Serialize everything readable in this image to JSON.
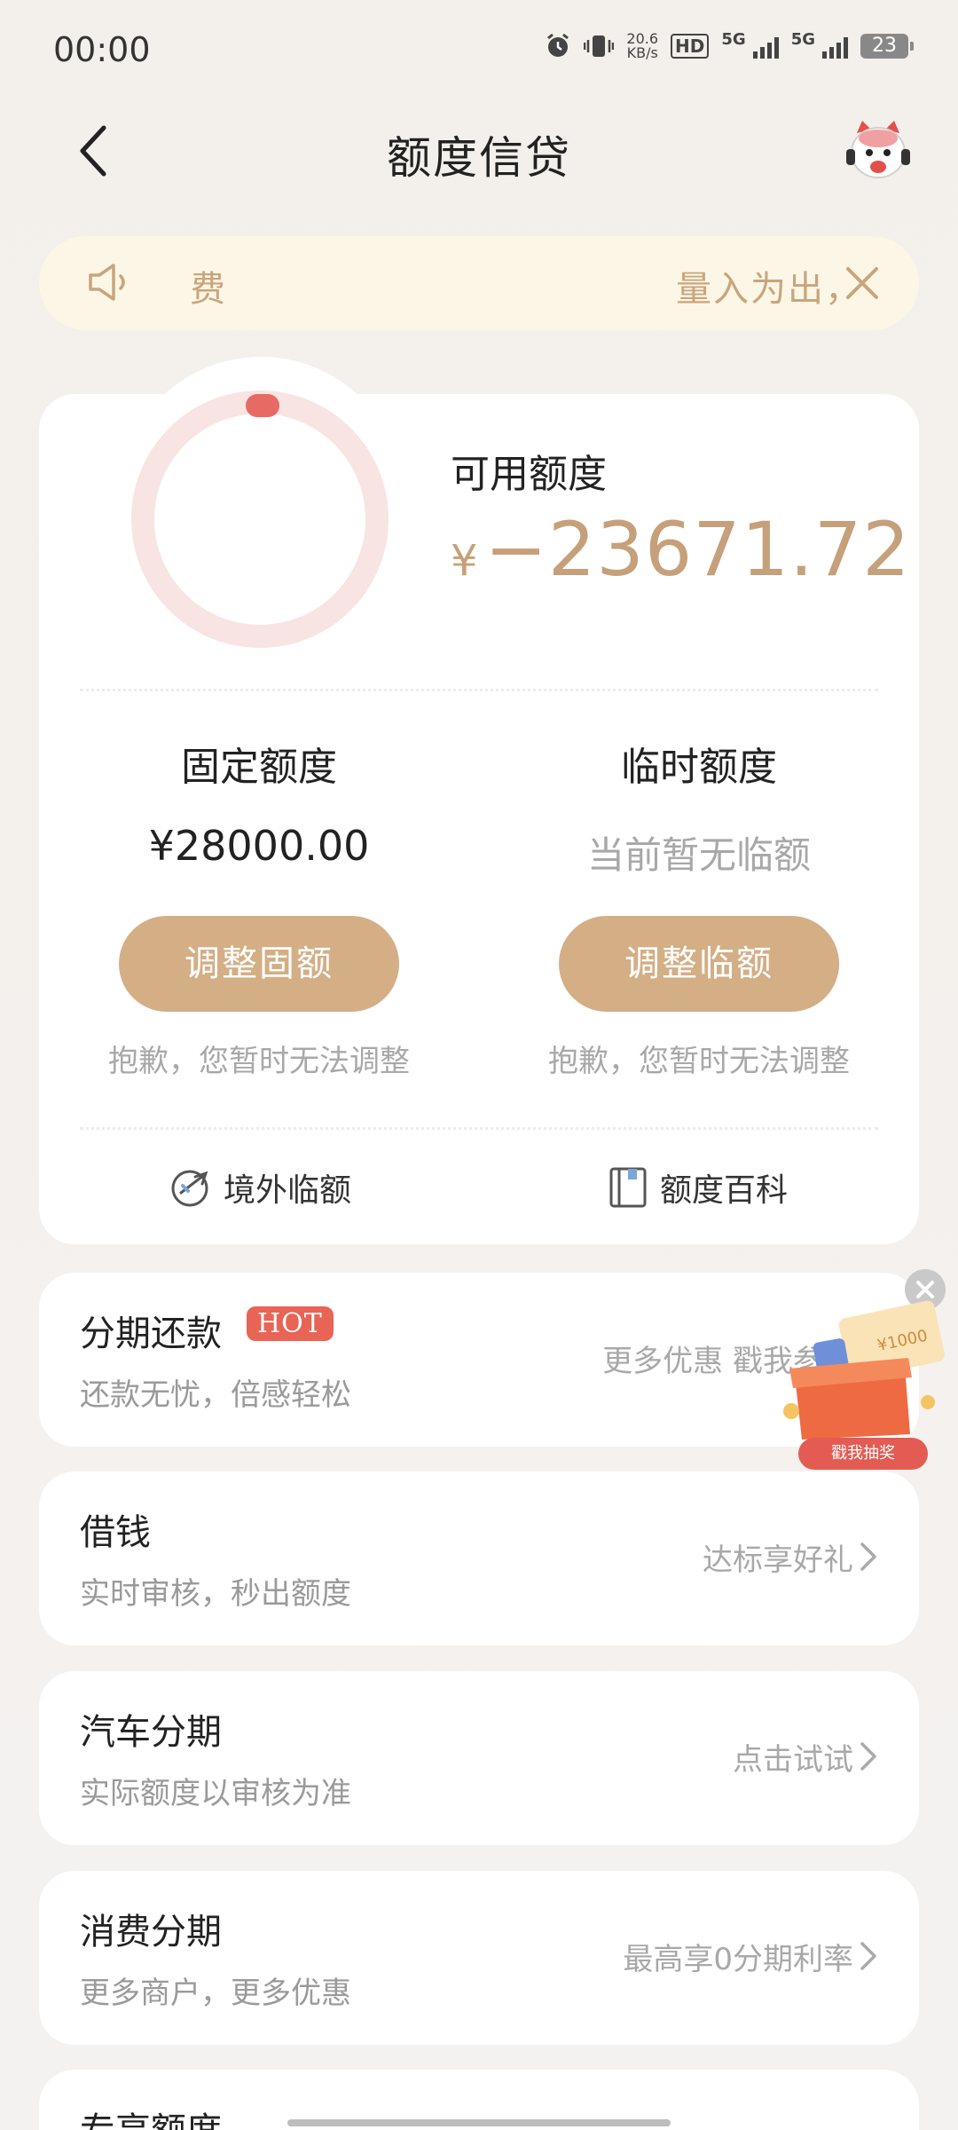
{
  "status_bar": {
    "time": "00:00",
    "net_speed_value": "20.6",
    "net_speed_unit": "KB/s",
    "hd_label": "HD",
    "sim1": "5G",
    "sim2": "5G",
    "battery": "23"
  },
  "header": {
    "title": "额度信贷"
  },
  "notice": {
    "left_text": "费",
    "right_text": "量入为出，"
  },
  "credit": {
    "available_label": "可用额度",
    "currency_symbol": "¥",
    "available_amount": "−23671.72",
    "fixed": {
      "title": "固定额度",
      "value": "¥28000.00",
      "button_label": "调整固额",
      "note": "抱歉，您暂时无法调整"
    },
    "temporary": {
      "title": "临时额度",
      "value": "当前暂无临额",
      "button_label": "调整临额",
      "note": "抱歉，您暂时无法调整"
    },
    "links": {
      "overseas": "境外临额",
      "encyclopedia": "额度百科"
    }
  },
  "products": [
    {
      "title": "分期还款",
      "badge": "HOT",
      "subtitle": "还款无忧，倍感轻松",
      "right_text": "更多优惠 戳我参与"
    },
    {
      "title": "借钱",
      "subtitle": "实时审核，秒出额度",
      "right_text": "达标享好礼"
    },
    {
      "title": "汽车分期",
      "subtitle": "实际额度以审核为准",
      "right_text": "点击试试"
    },
    {
      "title": "消费分期",
      "subtitle": "更多商户，更多优惠",
      "right_text": "最高享0分期利率"
    },
    {
      "title": "专享额度"
    }
  ],
  "promo": {
    "label": "戳我抽奖",
    "ticket_text": "¥1000"
  },
  "colors": {
    "accent_gold": "#c6a07a",
    "button_gold": "#d4ae85",
    "ring_track": "#f8e4e3",
    "ring_marker": "#e86a64",
    "hot_red": "#e86455"
  }
}
